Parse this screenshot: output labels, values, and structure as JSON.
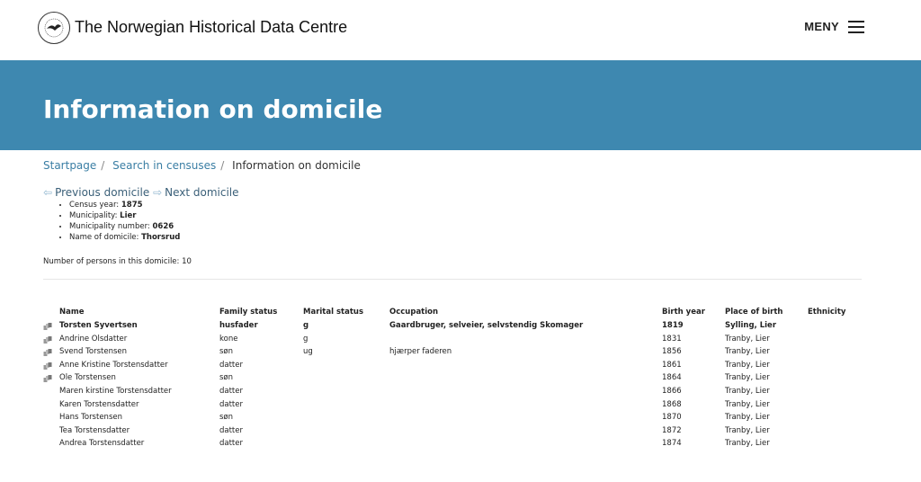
{
  "header": {
    "site_title": "The Norwegian Historical Data Centre",
    "menu_label": "MENY",
    "logo_icon": "university-logo-icon"
  },
  "banner": {
    "title": "Information on domicile"
  },
  "breadcrumb": {
    "items": [
      {
        "label": "Startpage"
      },
      {
        "label": "Search in censuses"
      },
      {
        "label": "Information on domicile"
      }
    ]
  },
  "domicile_nav": {
    "previous": "Previous domicile",
    "next": "Next domicile"
  },
  "info": {
    "census_year_label": "Census year:",
    "census_year": "1875",
    "municipality_label": "Municipality:",
    "municipality": "Lier",
    "municipality_number_label": "Municipality number:",
    "municipality_number": "0626",
    "domicile_name_label": "Name of domicile:",
    "domicile_name": "Thorsrud"
  },
  "persons_count_text": "Number of persons in this domicile: 10",
  "table": {
    "headers": {
      "name": "Name",
      "family_status": "Family status",
      "marital_status": "Marital status",
      "occupation": "Occupation",
      "birth_year": "Birth year",
      "place_of_birth": "Place of birth",
      "ethnicity": "Ethnicity"
    },
    "rows": [
      {
        "name": "Torsten Syvertsen",
        "family_status": "husfader",
        "marital_status": "g",
        "occupation": "Gaardbruger, selveier, selvstendig Skomager",
        "birth_year": "1819",
        "place_of_birth": "Sylling, Lier",
        "ethnicity": "",
        "has_link": true,
        "bold": true
      },
      {
        "name": "Andrine Olsdatter",
        "family_status": "kone",
        "marital_status": "g",
        "occupation": "",
        "birth_year": "1831",
        "place_of_birth": "Tranby, Lier",
        "ethnicity": "",
        "has_link": true,
        "bold": false
      },
      {
        "name": "Svend Torstensen",
        "family_status": "søn",
        "marital_status": "ug",
        "occupation": "hjærper faderen",
        "birth_year": "1856",
        "place_of_birth": "Tranby, Lier",
        "ethnicity": "",
        "has_link": true,
        "bold": false
      },
      {
        "name": "Anne Kristine Torstensdatter",
        "family_status": "datter",
        "marital_status": "",
        "occupation": "",
        "birth_year": "1861",
        "place_of_birth": "Tranby, Lier",
        "ethnicity": "",
        "has_link": true,
        "bold": false
      },
      {
        "name": "Ole Torstensen",
        "family_status": "søn",
        "marital_status": "",
        "occupation": "",
        "birth_year": "1864",
        "place_of_birth": "Tranby, Lier",
        "ethnicity": "",
        "has_link": true,
        "bold": false
      },
      {
        "name": "Maren kirstine Torstensdatter",
        "family_status": "datter",
        "marital_status": "",
        "occupation": "",
        "birth_year": "1866",
        "place_of_birth": "Tranby, Lier",
        "ethnicity": "",
        "has_link": false,
        "bold": false
      },
      {
        "name": "Karen Torstensdatter",
        "family_status": "datter",
        "marital_status": "",
        "occupation": "",
        "birth_year": "1868",
        "place_of_birth": "Tranby, Lier",
        "ethnicity": "",
        "has_link": false,
        "bold": false
      },
      {
        "name": "Hans Torstensen",
        "family_status": "søn",
        "marital_status": "",
        "occupation": "",
        "birth_year": "1870",
        "place_of_birth": "Tranby, Lier",
        "ethnicity": "",
        "has_link": false,
        "bold": false
      },
      {
        "name": "Tea Torstensdatter",
        "family_status": "datter",
        "marital_status": "",
        "occupation": "",
        "birth_year": "1872",
        "place_of_birth": "Tranby, Lier",
        "ethnicity": "",
        "has_link": false,
        "bold": false
      },
      {
        "name": "Andrea Torstensdatter",
        "family_status": "datter",
        "marital_status": "",
        "occupation": "",
        "birth_year": "1874",
        "place_of_birth": "Tranby, Lier",
        "ethnicity": "",
        "has_link": false,
        "bold": false
      }
    ]
  },
  "colors": {
    "banner": "#3e88b0",
    "link": "#3a7ea4"
  }
}
